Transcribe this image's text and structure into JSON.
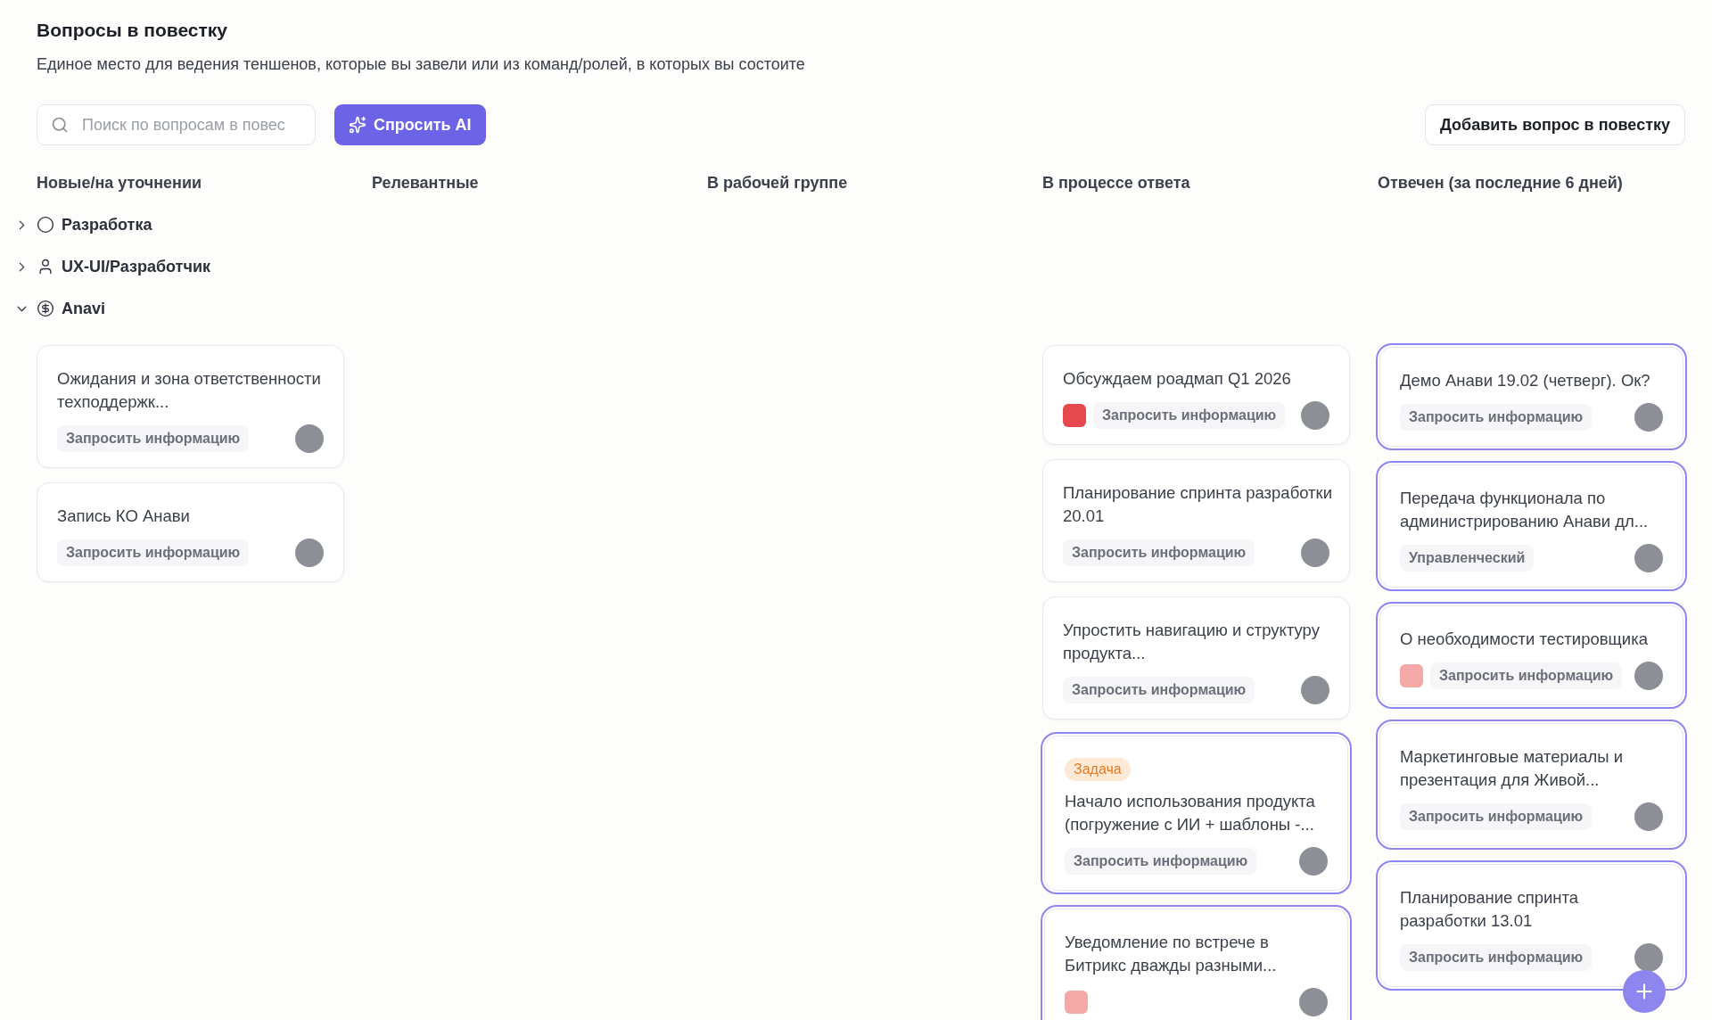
{
  "header": {
    "title": "Вопросы в повестку",
    "subtitle": "Единое место для ведения теншенов, которые вы завели или из команд/ролей, в которых вы состоите"
  },
  "toolbar": {
    "search": {
      "placeholder": "Поиск по вопросам в повес"
    },
    "ai_button": "Спросить AI",
    "add_button": "Добавить вопрос в повестку"
  },
  "groups": [
    {
      "label": "Разработка",
      "kind": "circle",
      "expanded": false
    },
    {
      "label": "UX-UI/Разработчик",
      "kind": "person",
      "expanded": false
    },
    {
      "label": "Anavi",
      "kind": "dollar",
      "expanded": true
    }
  ],
  "columns": [
    {
      "title": "Новые/на уточнении",
      "cards": [
        {
          "title": "Ожидания и зона ответственности техподдержк...",
          "tag": "Запросить информацию",
          "highlighted": false
        },
        {
          "title": "Запись КО Анави",
          "tag": "Запросить информацию",
          "highlighted": false
        }
      ]
    },
    {
      "title": "Релевантные"
    },
    {
      "title": "В рабочей группе"
    },
    {
      "title": "В процессе ответа",
      "cards": [
        {
          "title": "Обсуждаем роадмап Q1 2026",
          "tag": "Запросить информацию",
          "color": "#e5484d",
          "highlighted": false
        },
        {
          "title": "Планирование спринта разработки 20.01",
          "tag": "Запросить информацию",
          "highlighted": false
        },
        {
          "title": "Упростить навигацию и структуру продукта...",
          "tag": "Запросить информацию",
          "highlighted": false
        },
        {
          "title": "Начало использования продукта (погружение с ИИ + шаблоны -...",
          "badge": "Задача",
          "tag": "Запросить информацию",
          "highlighted": true
        },
        {
          "title": "Уведомление по встрече в Битрикс дважды разными...",
          "color": "#f4a9a8",
          "highlighted": true
        }
      ]
    },
    {
      "title": "Отвечен (за последние 6 дней)",
      "cards": [
        {
          "title": "Демо Анави 19.02 (четверг). Ок?",
          "tag": "Запросить информацию",
          "highlighted": true
        },
        {
          "title": "Передача функционала по администрированию Анави дл...",
          "tag": "Управленческий",
          "highlighted": true
        },
        {
          "title": "О необходимости тестировщика",
          "tag": "Запросить информацию",
          "color": "#f4a9a8",
          "highlighted": true
        },
        {
          "title": "Маркетинговые материалы и презентация для Живой...",
          "tag": "Запросить информацию",
          "highlighted": true
        },
        {
          "title": "Планирование спринта разработки 13.01",
          "tag": "Запросить информацию",
          "highlighted": true
        }
      ]
    }
  ]
}
